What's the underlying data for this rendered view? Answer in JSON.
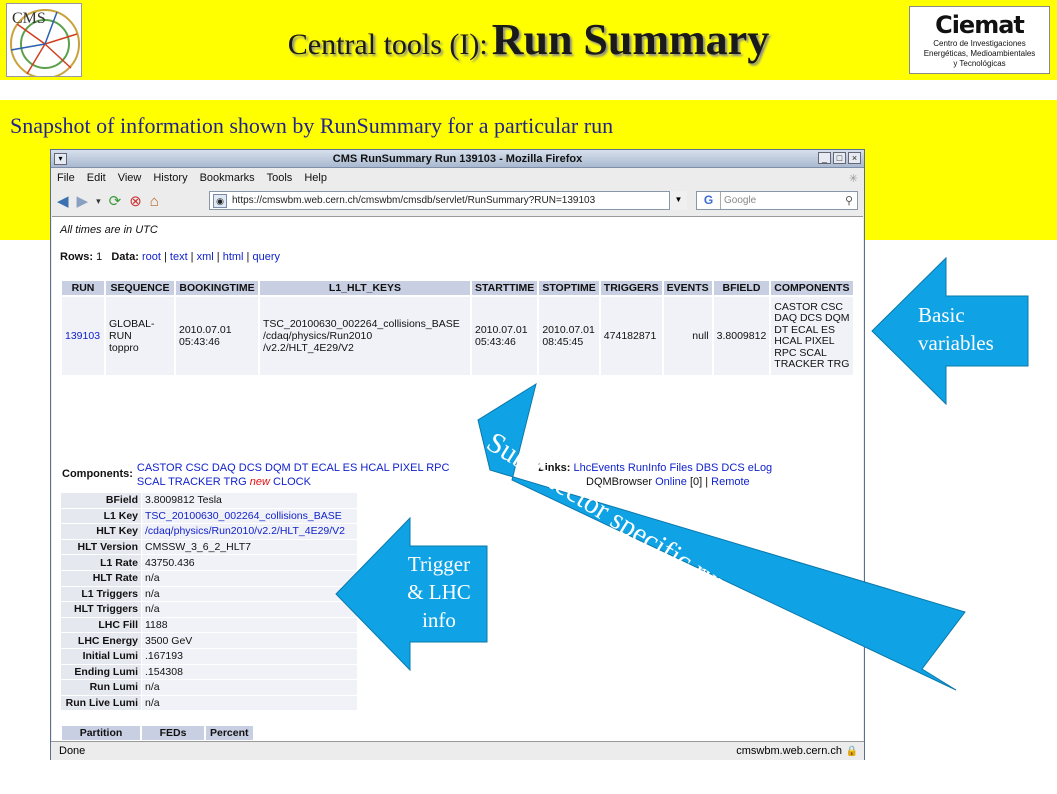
{
  "slide": {
    "title_plain": "Central tools (I):",
    "title_bold": "Run Summary",
    "subtitle": "Snapshot of information shown by RunSummary for a particular run",
    "cms_logo_text": "CMS",
    "ciemat_logo": {
      "brand": "Ciemat",
      "line1": "Centro de Investigaciones",
      "line2": "Energéticas, Medioambientales",
      "line3": "y Tecnológicas"
    },
    "colors": {
      "band": "#ffff00",
      "arrow": "#0fa3e6",
      "subtitle": "#23238e"
    }
  },
  "browser": {
    "window_title": "CMS RunSummary Run 139103 - Mozilla Firefox",
    "menu": [
      "File",
      "Edit",
      "View",
      "History",
      "Bookmarks",
      "Tools",
      "Help"
    ],
    "url": "https://cmswbm.web.cern.ch/cmswbm/cmsdb/servlet/RunSummary?RUN=139103",
    "search_engine": "G",
    "search_placeholder": "Google",
    "status": "Done",
    "status_host": "cmswbm.web.cern.ch"
  },
  "page": {
    "timezone_note": "All times are in UTC",
    "rows_label": "Rows:",
    "rows_value": "1",
    "data_label": "Data:",
    "data_links": [
      "root",
      "text",
      "xml",
      "html",
      "query"
    ],
    "run_table": {
      "headers": [
        "RUN",
        "SEQUENCE",
        "BOOKINGTIME",
        "L1_HLT_KEYS",
        "STARTTIME",
        "STOPTIME",
        "TRIGGERS",
        "EVENTS",
        "BFIELD",
        "COMPONENTS"
      ],
      "row": {
        "run": "139103",
        "sequence_1": "GLOBAL-RUN",
        "sequence_2": "toppro",
        "bookingtime_1": "2010.07.01",
        "bookingtime_2": "05:43:46",
        "keys_1": "TSC_20100630_002264_collisions_BASE",
        "keys_2": "/cdaq/physics/Run2010",
        "keys_3": "/v2.2/HLT_4E29/V2",
        "starttime_1": "2010.07.01",
        "starttime_2": "05:43:46",
        "stoptime_1": "2010.07.01",
        "stoptime_2": "08:45:45",
        "triggers": "474182871",
        "events": "null",
        "bfield": "3.8009812",
        "comp_1": "CASTOR CSC",
        "comp_2": "DAQ DCS DQM",
        "comp_3": "DT ECAL ES",
        "comp_4": "HCAL PIXEL",
        "comp_5": "RPC SCAL",
        "comp_6": "TRACKER TRG"
      }
    },
    "components_label": "Components:",
    "components_line1": "CASTOR CSC DAQ DCS DQM DT ECAL ES HCAL PIXEL RPC",
    "components_line2_a": "SCAL TRACKER TRG",
    "components_new": "new",
    "components_clock": "CLOCK",
    "links_label": "Links:",
    "links_line1": "LhcEvents RunInfo Files DBS DCS eLog",
    "links_dqm": "DQMBrowser",
    "links_online": "Online",
    "links_count": "[0] |",
    "links_remote": "Remote",
    "info": [
      {
        "k": "BField",
        "v": "3.8009812 Tesla",
        "link": false
      },
      {
        "k": "L1 Key",
        "v": "TSC_20100630_002264_collisions_BASE",
        "link": true
      },
      {
        "k": "HLT Key",
        "v": "/cdaq/physics/Run2010/v2.2/HLT_4E29/V2",
        "link": true
      },
      {
        "k": "HLT Version",
        "v": "CMSSW_3_6_2_HLT7",
        "link": false
      },
      {
        "k": "L1 Rate",
        "v": "43750.436",
        "link": false
      },
      {
        "k": "HLT Rate",
        "v": "n/a",
        "link": false
      },
      {
        "k": "L1 Triggers",
        "v": "n/a",
        "link": false
      },
      {
        "k": "HLT Triggers",
        "v": "n/a",
        "link": false
      },
      {
        "k": "LHC Fill",
        "v": "1188",
        "link": false
      },
      {
        "k": "LHC Energy",
        "v": "3500 GeV",
        "link": false
      },
      {
        "k": "Initial Lumi",
        "v": ".167193",
        "link": false
      },
      {
        "k": "Ending Lumi",
        "v": ".154308",
        "link": false
      },
      {
        "k": "Run Lumi",
        "v": "n/a",
        "link": false
      },
      {
        "k": "Run Live Lumi",
        "v": "n/a",
        "link": false
      }
    ],
    "partition_headers": [
      "Partition",
      "FEDs",
      "Percent"
    ]
  },
  "callouts": {
    "basic_1": "Basic",
    "basic_2": "variables",
    "trigger_1": "Trigger",
    "trigger_2": "& LHC",
    "trigger_3": "info",
    "subdetector": "Subdetector specific run summaries"
  }
}
